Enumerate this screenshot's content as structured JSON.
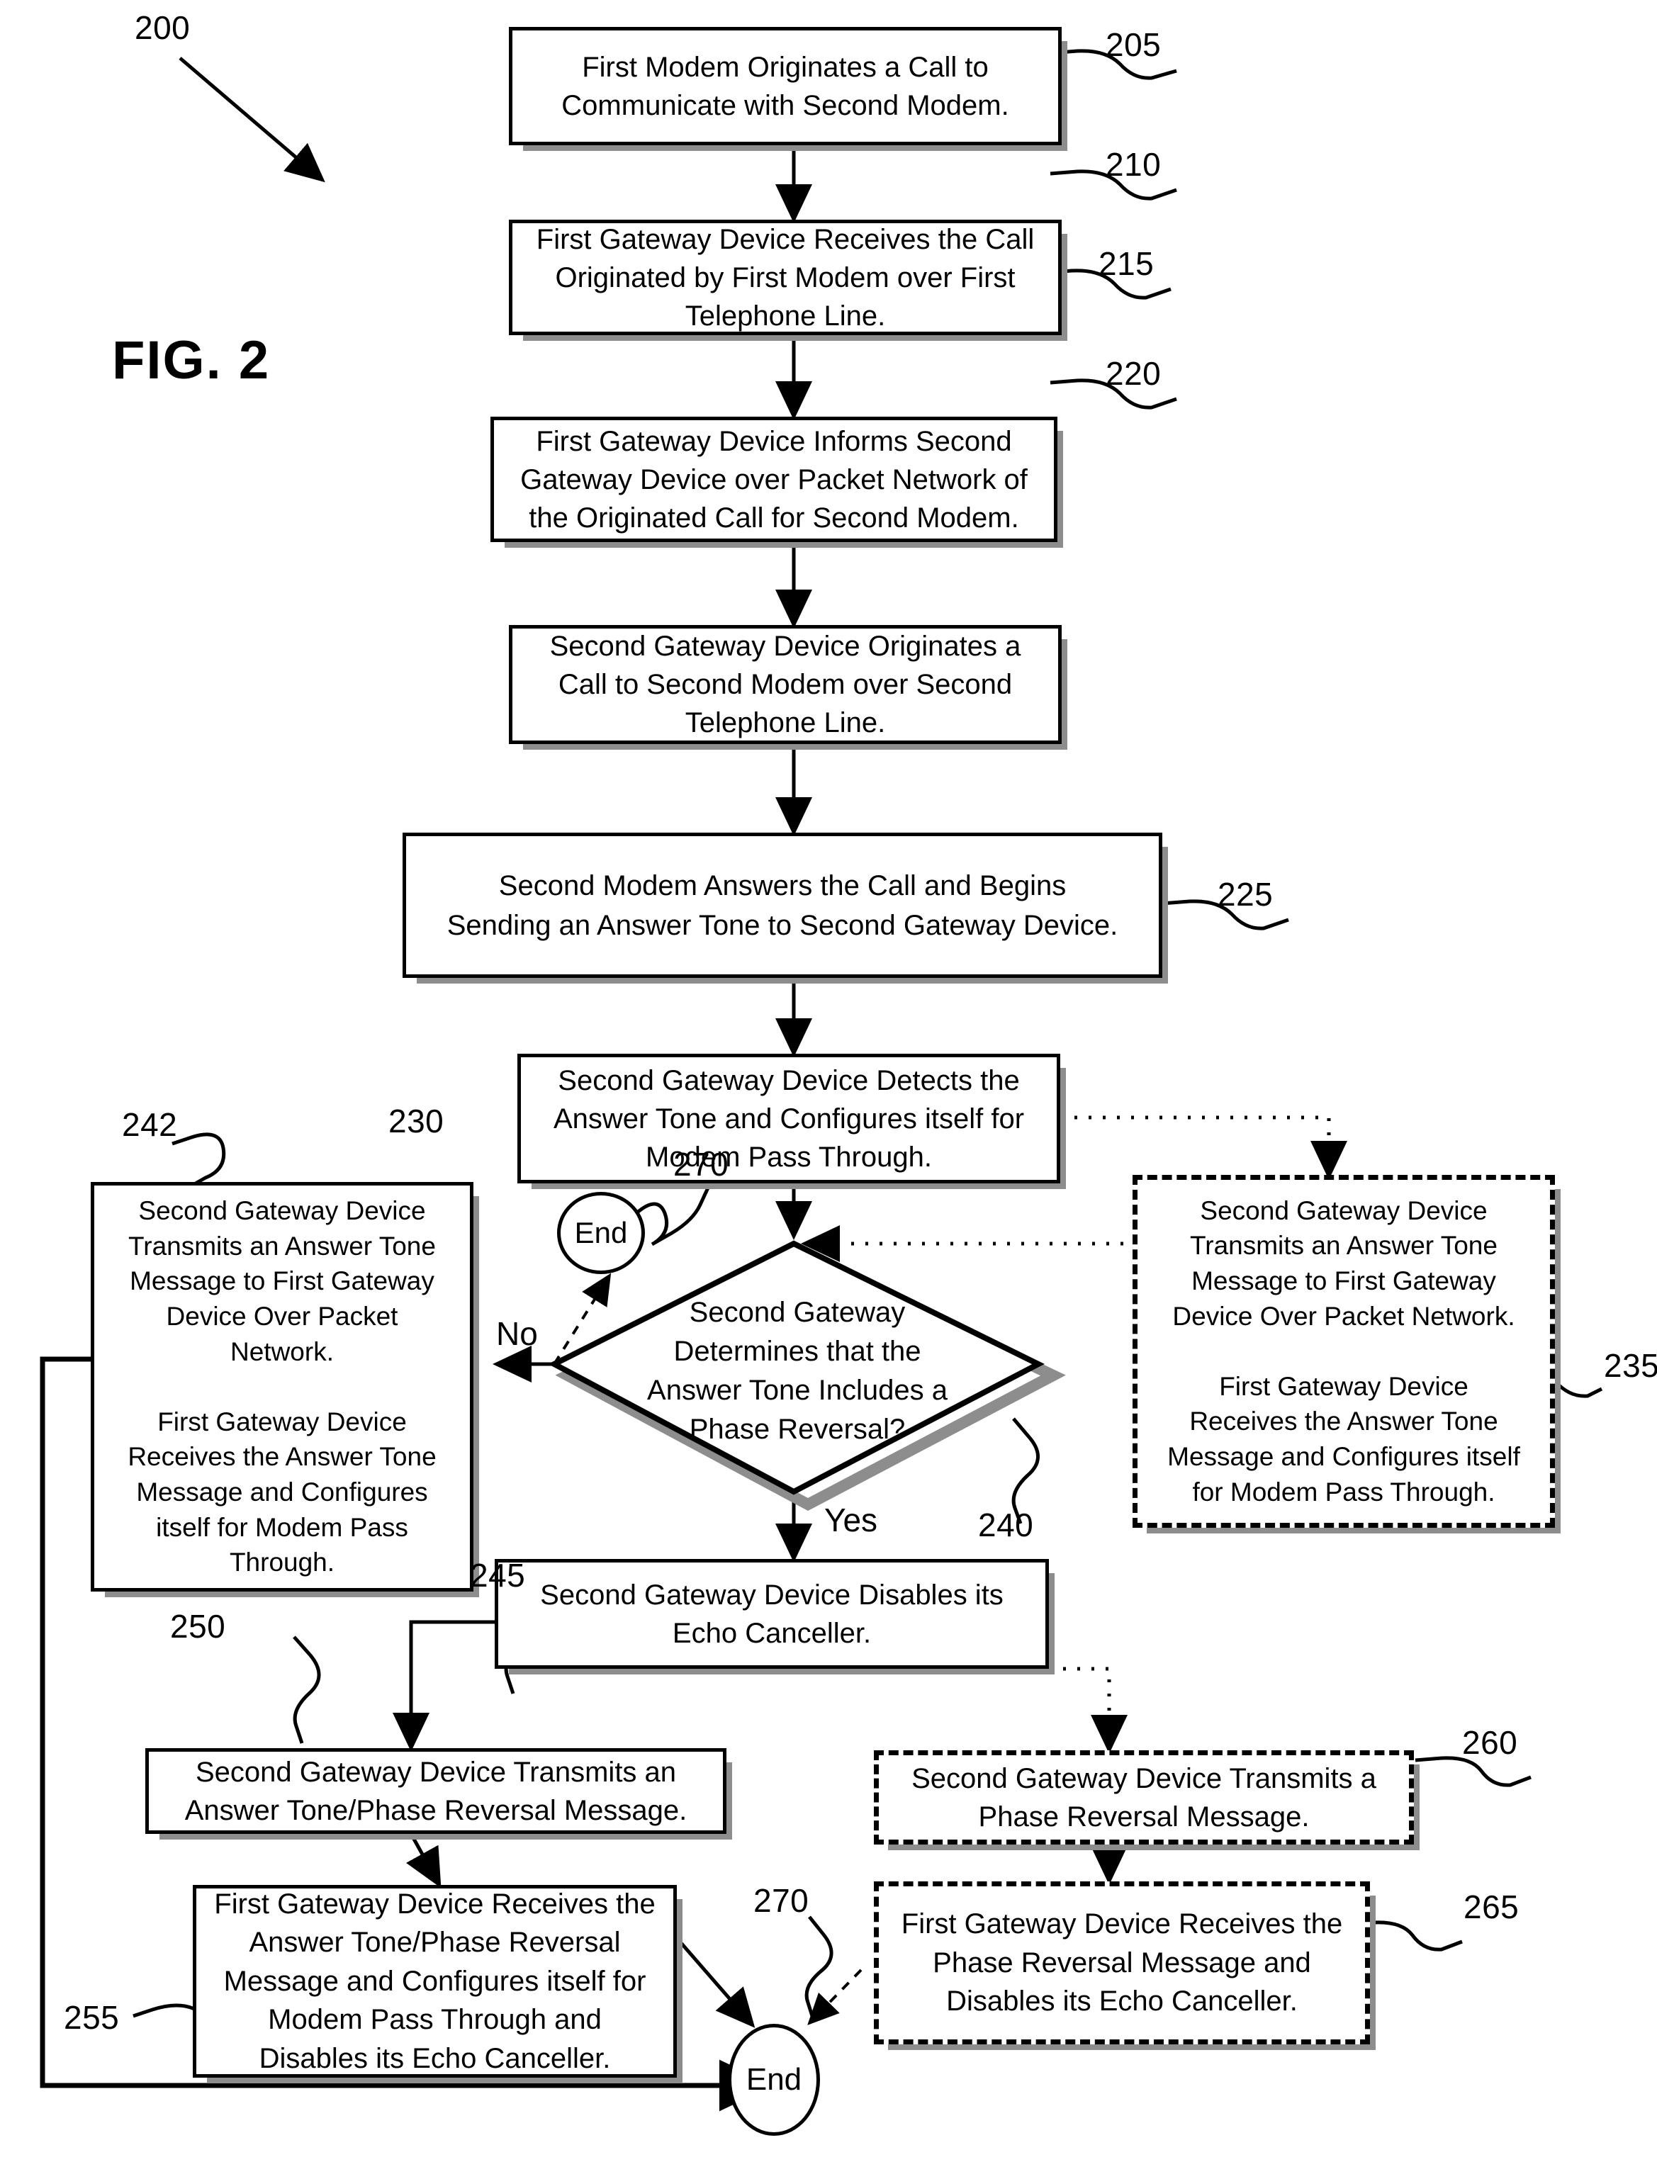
{
  "figure": {
    "label": "FIG. 2",
    "diagram_ref": "200"
  },
  "nodes": [
    {
      "id": "205",
      "ref": "205",
      "shape": "process",
      "style": "solid",
      "text": "First Modem Originates a Call to\nCommunicate with Second Modem."
    },
    {
      "id": "210",
      "ref": "210",
      "shape": "process",
      "style": "solid",
      "text": "First Gateway Device Receives the Call\nOriginated by First Modem over First\nTelephone Line."
    },
    {
      "id": "215",
      "ref": "215",
      "shape": "process",
      "style": "solid",
      "text": "First Gateway Device Informs Second\nGateway Device over Packet Network of\nthe Originated Call for Second Modem."
    },
    {
      "id": "220",
      "ref": "220",
      "shape": "process",
      "style": "solid",
      "text": "Second Gateway Device Originates a\nCall to Second Modem over Second\nTelephone Line."
    },
    {
      "id": "225",
      "ref": "225",
      "shape": "process",
      "style": "solid",
      "text": "Second Modem Answers the Call and Begins\nSending an Answer Tone to Second Gateway Device."
    },
    {
      "id": "230",
      "ref": "230",
      "shape": "process",
      "style": "solid",
      "text": "Second Gateway Device Detects the\nAnswer Tone and Configures itself for\nModem Pass Through."
    },
    {
      "id": "240",
      "ref": "240",
      "shape": "decision",
      "style": "solid",
      "text": "Second Gateway\nDetermines that the\nAnswer Tone Includes a\nPhase Reversal?"
    },
    {
      "id": "242",
      "ref": "242",
      "shape": "process",
      "style": "solid",
      "text": "Second Gateway Device\nTransmits an Answer Tone\nMessage to First Gateway\nDevice Over Packet\nNetwork.\n\nFirst Gateway Device\nReceives the Answer Tone\nMessage and Configures\nitself for Modem Pass\nThrough."
    },
    {
      "id": "235",
      "ref": "235",
      "shape": "process",
      "style": "dashed",
      "text": "Second Gateway Device\nTransmits an Answer Tone\nMessage to First Gateway\nDevice Over Packet Network.\n\nFirst Gateway Device\nReceives the Answer Tone\nMessage and Configures itself\nfor Modem Pass Through."
    },
    {
      "id": "245",
      "ref": "245",
      "shape": "process",
      "style": "solid",
      "text": "Second Gateway Device Disables its\nEcho Canceller."
    },
    {
      "id": "250",
      "ref": "250",
      "shape": "process",
      "style": "solid",
      "text": "Second Gateway Device Transmits an\nAnswer Tone/Phase Reversal Message."
    },
    {
      "id": "260",
      "ref": "260",
      "shape": "process",
      "style": "dashed",
      "text": "Second Gateway Device Transmits a\nPhase Reversal Message."
    },
    {
      "id": "255",
      "ref": "255",
      "shape": "process",
      "style": "solid",
      "text": "First Gateway Device Receives the\nAnswer Tone/Phase Reversal\nMessage and Configures itself for\nModem Pass Through and\nDisables its Echo Canceller."
    },
    {
      "id": "265",
      "ref": "265",
      "shape": "process",
      "style": "dashed",
      "text": "First Gateway Device Receives the\nPhase Reversal Message and\nDisables its Echo Canceller."
    }
  ],
  "terminators": [
    {
      "id": "end_top",
      "ref": "270",
      "text": "End"
    },
    {
      "id": "end_bottom",
      "ref": "270",
      "text": "End"
    }
  ],
  "branch_labels": {
    "no": "No",
    "yes": "Yes"
  },
  "reference_numerals": [
    "200",
    "205",
    "210",
    "215",
    "220",
    "225",
    "230",
    "235",
    "240",
    "242",
    "245",
    "250",
    "255",
    "260",
    "265",
    "270",
    "270"
  ],
  "colors": {
    "ink": "#000000",
    "paper": "#ffffff",
    "shadow": "#8d8d8d"
  }
}
